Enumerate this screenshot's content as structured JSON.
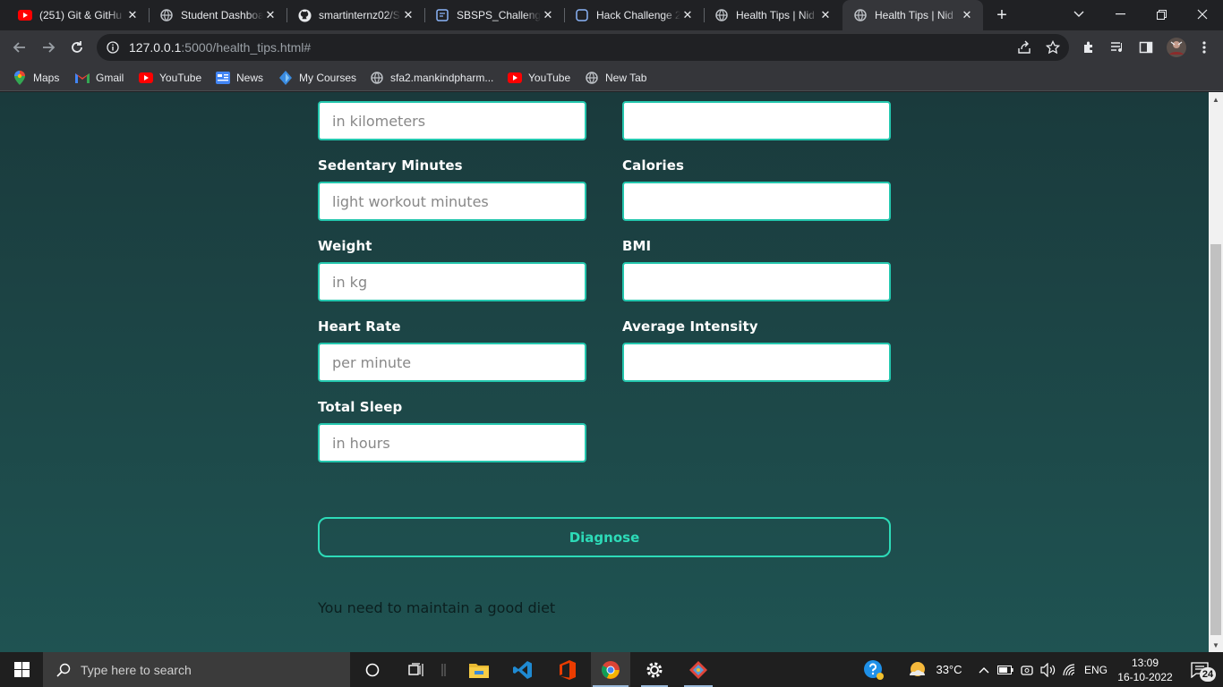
{
  "browser": {
    "tabs": [
      {
        "title": "(251) Git & GitHu",
        "icon": "youtube-icon"
      },
      {
        "title": "Student Dashboa",
        "icon": "globe-icon"
      },
      {
        "title": "smartinternz02/S",
        "icon": "github-icon"
      },
      {
        "title": "SBSPS_Challenge",
        "icon": "document-icon"
      },
      {
        "title": "Hack Challenge 2",
        "icon": "challenge-icon"
      },
      {
        "title": "Health Tips | Nid",
        "icon": "globe-icon"
      },
      {
        "title": "Health Tips | Nid",
        "icon": "globe-icon",
        "active": true
      }
    ],
    "url_host": "127.0.0.1",
    "url_rest": ":5000/health_tips.html#",
    "bookmarks": [
      {
        "label": "Maps",
        "icon": "maps-icon"
      },
      {
        "label": "Gmail",
        "icon": "gmail-icon"
      },
      {
        "label": "YouTube",
        "icon": "youtube-icon"
      },
      {
        "label": "News",
        "icon": "news-icon"
      },
      {
        "label": "My Courses",
        "icon": "courses-icon"
      },
      {
        "label": "sfa2.mankindpharm...",
        "icon": "globe-icon"
      },
      {
        "label": "YouTube",
        "icon": "youtube-icon"
      },
      {
        "label": "New Tab",
        "icon": "globe-icon"
      }
    ]
  },
  "form": {
    "fields": [
      {
        "label": "Sedentary Minutes",
        "placeholder": "light workout minutes"
      },
      {
        "label": "Calories",
        "placeholder": ""
      },
      {
        "label": "Weight",
        "placeholder": "in kg"
      },
      {
        "label": "BMI",
        "placeholder": ""
      },
      {
        "label": "Heart Rate",
        "placeholder": "per minute"
      },
      {
        "label": "Average Intensity",
        "placeholder": ""
      },
      {
        "label": "Total Sleep",
        "placeholder": "in hours"
      }
    ],
    "top_left_placeholder": "in kilometers",
    "top_right_placeholder": "",
    "submit_label": "Diagnose",
    "result_text": "You need to maintain a good diet"
  },
  "taskbar": {
    "search_placeholder": "Type here to search",
    "weather_temp": "33°C",
    "language": "ENG",
    "time": "13:09",
    "date": "16-10-2022",
    "notification_count": "24"
  },
  "colors": {
    "accent": "#2ddbb8",
    "page_bg_top": "#1a3a3c",
    "page_bg_bottom": "#1f5352"
  }
}
